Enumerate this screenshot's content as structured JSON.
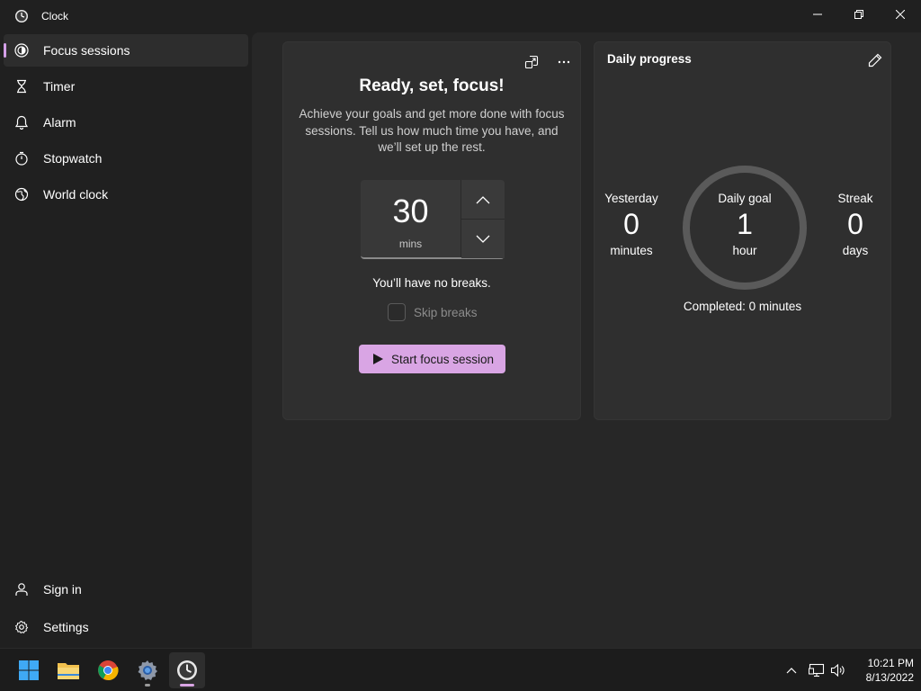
{
  "window": {
    "title": "Clock"
  },
  "sidebar": {
    "items": [
      {
        "label": "Focus sessions",
        "icon": "focus-icon",
        "selected": true
      },
      {
        "label": "Timer",
        "icon": "hourglass-icon"
      },
      {
        "label": "Alarm",
        "icon": "bell-icon"
      },
      {
        "label": "Stopwatch",
        "icon": "stopwatch-icon"
      },
      {
        "label": "World clock",
        "icon": "globe-icon"
      }
    ],
    "footer": [
      {
        "label": "Sign in",
        "icon": "person-icon"
      },
      {
        "label": "Settings",
        "icon": "gear-icon"
      }
    ]
  },
  "focus": {
    "title": "Ready, set, focus!",
    "description": "Achieve your goals and get more done with focus sessions. Tell us how much time you have, and we’ll set up the rest.",
    "duration_value": "30",
    "duration_unit": "mins",
    "breaks_text": "You’ll have no breaks.",
    "skip_breaks_label": "Skip breaks",
    "skip_breaks_checked": false,
    "start_label": "Start focus session"
  },
  "progress": {
    "title": "Daily progress",
    "yesterday": {
      "label": "Yesterday",
      "value": "0",
      "unit": "minutes"
    },
    "daily_goal": {
      "label": "Daily goal",
      "value": "1",
      "unit": "hour"
    },
    "streak": {
      "label": "Streak",
      "value": "0",
      "unit": "days"
    },
    "completed_text": "Completed: 0 minutes",
    "completed_fraction": 0
  },
  "taskbar": {
    "apps": [
      "start-icon",
      "file-explorer-icon",
      "chrome-icon",
      "settings-app-icon",
      "clock-app-icon"
    ],
    "time": "10:21 PM",
    "date": "8/13/2022"
  },
  "colors": {
    "accent": "#d9a5e4",
    "background": "#202020",
    "card": "#2f2f2f"
  }
}
